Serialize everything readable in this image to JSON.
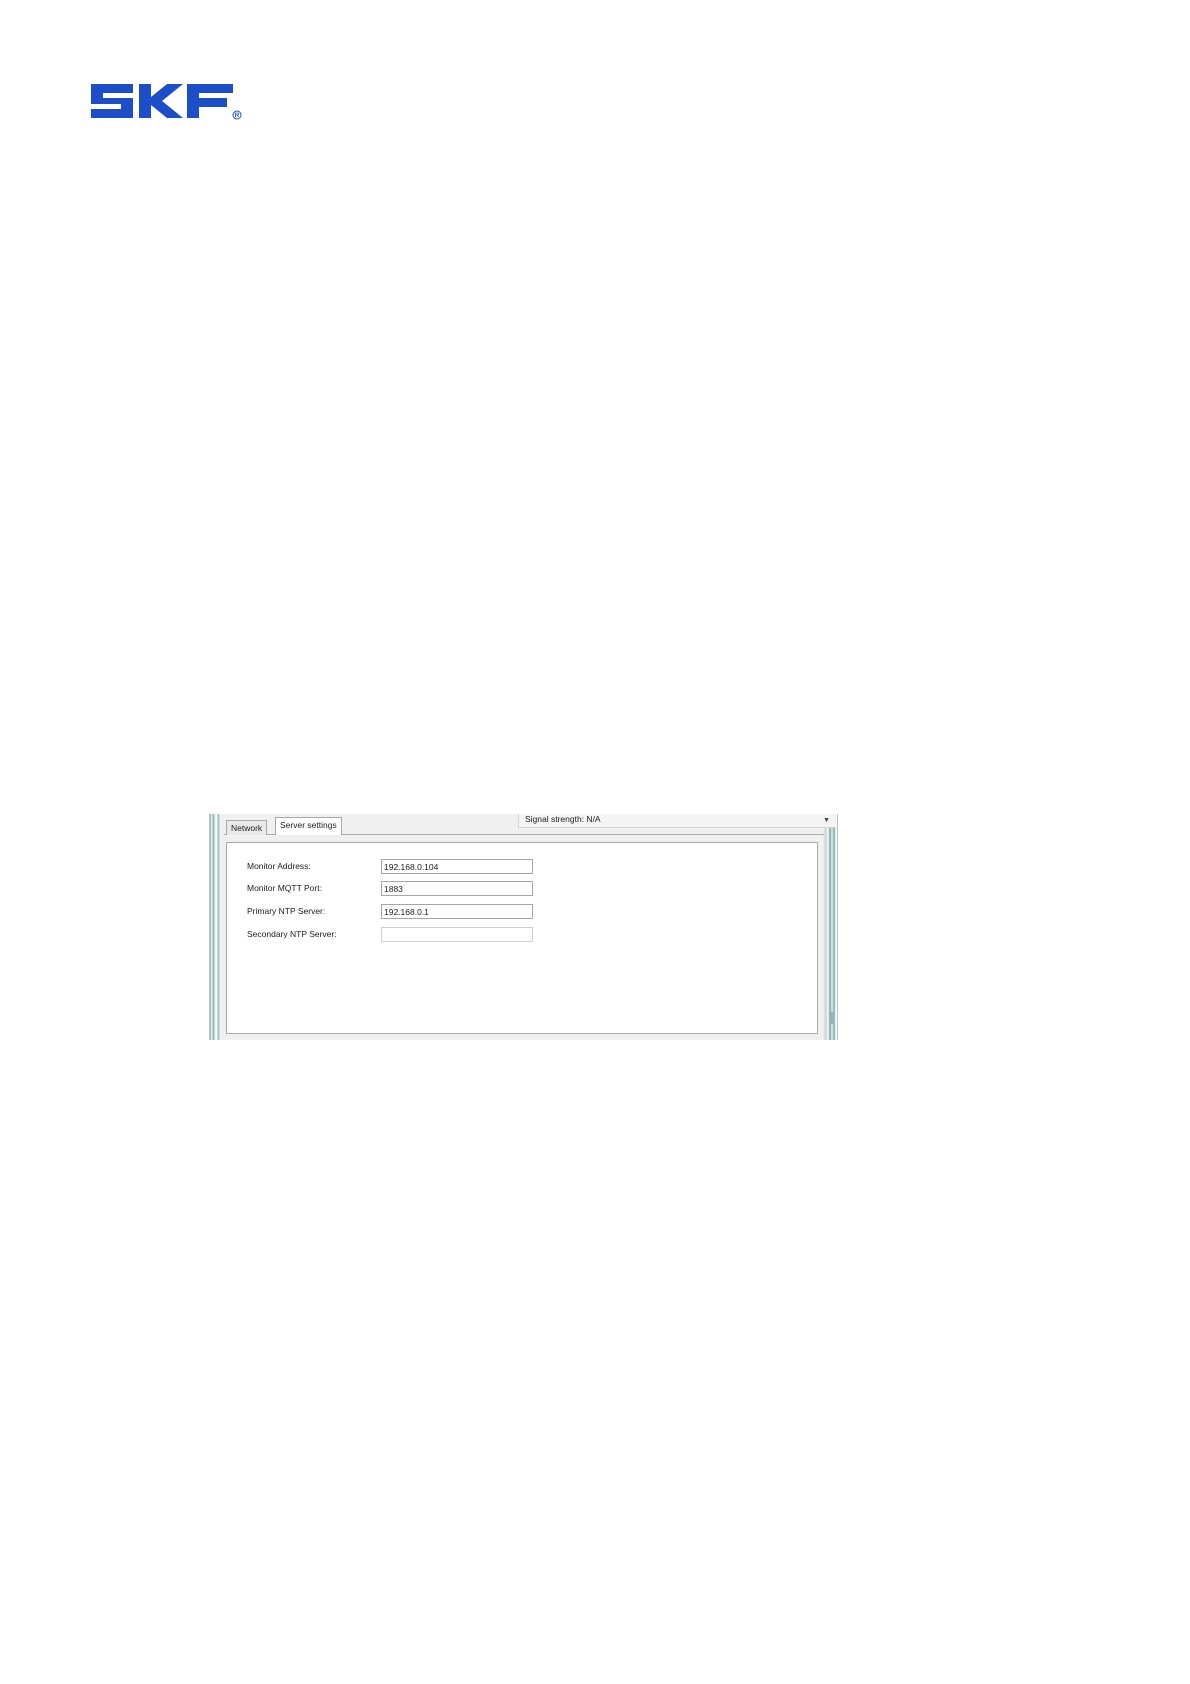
{
  "logo": {
    "text": "SKF",
    "mark": "®",
    "color": "#1d4ec9"
  },
  "window": {
    "tabs": [
      {
        "label": "Network",
        "active": false
      },
      {
        "label": "Server settings",
        "active": true
      }
    ],
    "signal_strength": "Signal strength: N/A",
    "dropdown_icon": "chevron-down-icon",
    "fields": [
      {
        "label": "Monitor Address:",
        "value": "192.168.0.104"
      },
      {
        "label": "Monitor MQTT Port:",
        "value": "1883"
      },
      {
        "label": "Primary NTP Server:",
        "value": "192.168.0.1"
      },
      {
        "label": "Secondary NTP Server:",
        "value": ""
      }
    ]
  }
}
